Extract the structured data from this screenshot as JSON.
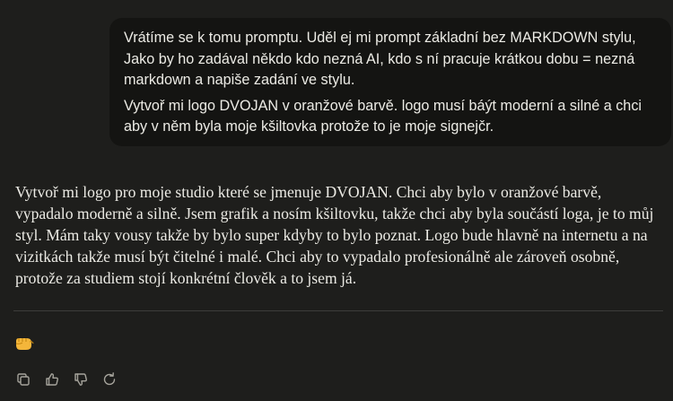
{
  "user_message": {
    "paragraphs": [
      "Vrátíme se k tomu promptu. Uděl ej mi prompt základní bez MARKDOWN stylu, Jako by ho zadával někdo kdo nezná AI, kdo s ní pracuje krátkou dobu = nezná markdown a napiše zadání ve stylu.",
      "Vytvoř mi logo DVOJAN v oranžové barvě. logo musí báýt moderní a silné a chci aby v něm byla moje kšiltovka protože to je moje signejčr."
    ]
  },
  "assistant_message": {
    "text": "Vytvoř mi logo pro moje studio které se jmenuje DVOJAN. Chci aby bylo v oranžové barvě, vypadalo moderně a silně. Jsem grafik a nosím kšiltovku, takže chci aby byla součástí loga, je to můj styl. Mám taky vousy takže by bylo super kdyby to bylo poznat. Logo bude hlavně na internetu a na vizitkách takže musí být čitelné i malé. Chci aby to vypadalo profesionálně ale zároveň osobně, protože za studiem stojí konkrétní člověk a to jsem já.",
    "reaction_emoji": "fist-bump-emoji"
  },
  "actions": [
    {
      "icon": "copy-icon"
    },
    {
      "icon": "thumbs-up-icon"
    },
    {
      "icon": "thumbs-down-icon"
    },
    {
      "icon": "retry-icon"
    }
  ],
  "colors": {
    "background": "#1e1e1c",
    "user_bubble": "#141412",
    "text": "#ecebe5",
    "icon": "#a6a49c",
    "divider": "#3d3d3a",
    "emoji": "#f4b63a"
  }
}
